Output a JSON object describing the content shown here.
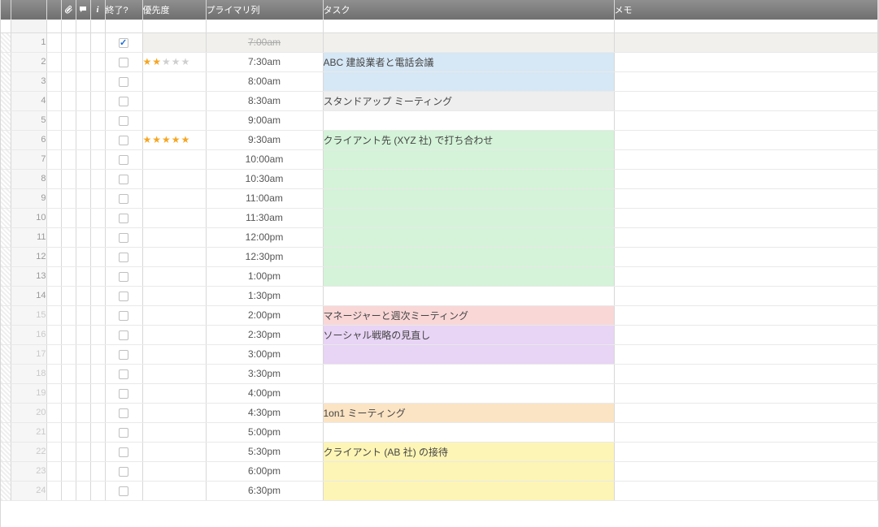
{
  "headers": {
    "done": "終了?",
    "priority": "優先度",
    "primary": "プライマリ列",
    "task": "タスク",
    "memo": "メモ"
  },
  "icons": {
    "attachment": "attachment-icon",
    "comment": "comment-icon",
    "info": "info-icon"
  },
  "colors": {
    "blue": "#d6e7f5",
    "grey": "#eeeeee",
    "green": "#d4f3d8",
    "pink": "#f9d7d7",
    "purple": "#e8d4f5",
    "orange": "#fbe4c4",
    "yellow": "#fdf5b5"
  },
  "rows": [
    {
      "n": 1,
      "done": true,
      "stars": 0,
      "time": "7:00am",
      "task": "",
      "color": "",
      "struck": true
    },
    {
      "n": 2,
      "done": false,
      "stars": 2,
      "time": "7:30am",
      "task": "ABC 建設業者と電話会議",
      "color": "blue",
      "struck": false
    },
    {
      "n": 3,
      "done": false,
      "stars": 0,
      "time": "8:00am",
      "task": "",
      "color": "blue",
      "struck": false
    },
    {
      "n": 4,
      "done": false,
      "stars": 0,
      "time": "8:30am",
      "task": "スタンドアップ ミーティング",
      "color": "grey",
      "struck": false
    },
    {
      "n": 5,
      "done": false,
      "stars": 0,
      "time": "9:00am",
      "task": "",
      "color": "",
      "struck": false
    },
    {
      "n": 6,
      "done": false,
      "stars": 5,
      "time": "9:30am",
      "task": "クライアント先 (XYZ 社) で打ち合わせ",
      "color": "green",
      "struck": false
    },
    {
      "n": 7,
      "done": false,
      "stars": 0,
      "time": "10:00am",
      "task": "",
      "color": "green",
      "struck": false
    },
    {
      "n": 8,
      "done": false,
      "stars": 0,
      "time": "10:30am",
      "task": "",
      "color": "green",
      "struck": false
    },
    {
      "n": 9,
      "done": false,
      "stars": 0,
      "time": "11:00am",
      "task": "",
      "color": "green",
      "struck": false
    },
    {
      "n": 10,
      "done": false,
      "stars": 0,
      "time": "11:30am",
      "task": "",
      "color": "green",
      "struck": false
    },
    {
      "n": 11,
      "done": false,
      "stars": 0,
      "time": "12:00pm",
      "task": "",
      "color": "green",
      "struck": false
    },
    {
      "n": 12,
      "done": false,
      "stars": 0,
      "time": "12:30pm",
      "task": "",
      "color": "green",
      "struck": false
    },
    {
      "n": 13,
      "done": false,
      "stars": 0,
      "time": "1:00pm",
      "task": "",
      "color": "green",
      "struck": false
    },
    {
      "n": 14,
      "done": false,
      "stars": 0,
      "time": "1:30pm",
      "task": "",
      "color": "",
      "struck": false
    },
    {
      "n": 15,
      "done": false,
      "stars": 0,
      "time": "2:00pm",
      "task": "マネージャーと週次ミーティング",
      "color": "pink",
      "struck": false,
      "dim": true
    },
    {
      "n": 16,
      "done": false,
      "stars": 0,
      "time": "2:30pm",
      "task": "ソーシャル戦略の見直し",
      "color": "purple",
      "struck": false,
      "dim": true
    },
    {
      "n": 17,
      "done": false,
      "stars": 0,
      "time": "3:00pm",
      "task": "",
      "color": "purple",
      "struck": false,
      "dim": true
    },
    {
      "n": 18,
      "done": false,
      "stars": 0,
      "time": "3:30pm",
      "task": "",
      "color": "",
      "struck": false,
      "dim": true
    },
    {
      "n": 19,
      "done": false,
      "stars": 0,
      "time": "4:00pm",
      "task": "",
      "color": "",
      "struck": false,
      "dim": true
    },
    {
      "n": 20,
      "done": false,
      "stars": 0,
      "time": "4:30pm",
      "task": "1on1 ミーティング",
      "color": "orange",
      "struck": false,
      "dim": true
    },
    {
      "n": 21,
      "done": false,
      "stars": 0,
      "time": "5:00pm",
      "task": "",
      "color": "",
      "struck": false,
      "dim": true
    },
    {
      "n": 22,
      "done": false,
      "stars": 0,
      "time": "5:30pm",
      "task": "クライアント (AB 社) の接待",
      "color": "yellow",
      "struck": false,
      "dim": true
    },
    {
      "n": 23,
      "done": false,
      "stars": 0,
      "time": "6:00pm",
      "task": "",
      "color": "yellow",
      "struck": false,
      "dim": true
    },
    {
      "n": 24,
      "done": false,
      "stars": 0,
      "time": "6:30pm",
      "task": "",
      "color": "yellow",
      "struck": false,
      "dim": true
    }
  ]
}
